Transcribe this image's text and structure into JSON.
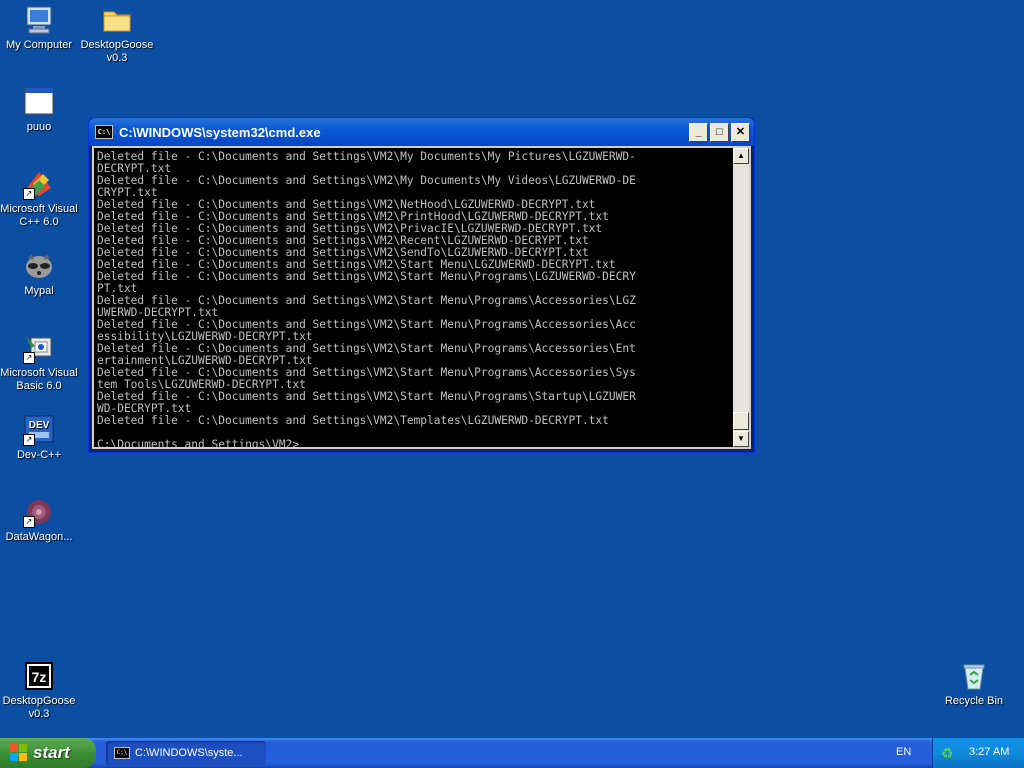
{
  "desktop": {
    "icons": [
      {
        "label_line1": "My Computer",
        "label_line2": "",
        "icon": "computer-icon"
      },
      {
        "label_line1": "DesktopGoose",
        "label_line2": "v0.3",
        "icon": "folder-icon"
      },
      {
        "label_line1": "puuo",
        "label_line2": "",
        "icon": "window-icon"
      },
      {
        "label_line1": "Microsoft Visual",
        "label_line2": "C++ 6.0",
        "icon": "visual-cpp-icon"
      },
      {
        "label_line1": "Mypal",
        "label_line2": "",
        "icon": "raccoon-icon"
      },
      {
        "label_line1": "Microsoft Visual",
        "label_line2": "Basic 6.0",
        "icon": "visual-basic-icon"
      },
      {
        "label_line1": "Dev-C++",
        "label_line2": "",
        "icon": "dev-cpp-icon"
      },
      {
        "label_line1": "DataWagon...",
        "label_line2": "",
        "icon": "datawagon-icon"
      },
      {
        "label_line1": "DesktopGoose",
        "label_line2": "v0.3",
        "icon": "7zip-icon"
      },
      {
        "label_line1": "Recycle Bin",
        "label_line2": "",
        "icon": "recycle-bin-icon"
      }
    ]
  },
  "cmd_window": {
    "title": "C:\\WINDOWS\\system32\\cmd.exe",
    "icon_text": "C:\\",
    "minimize": "_",
    "maximize": "□",
    "close": "✕",
    "lines": [
      "Deleted file - C:\\Documents and Settings\\VM2\\My Documents\\My Pictures\\LGZUWERWD-",
      "DECRYPT.txt",
      "Deleted file - C:\\Documents and Settings\\VM2\\My Documents\\My Videos\\LGZUWERWD-DE",
      "CRYPT.txt",
      "Deleted file - C:\\Documents and Settings\\VM2\\NetHood\\LGZUWERWD-DECRYPT.txt",
      "Deleted file - C:\\Documents and Settings\\VM2\\PrintHood\\LGZUWERWD-DECRYPT.txt",
      "Deleted file - C:\\Documents and Settings\\VM2\\PrivacIE\\LGZUWERWD-DECRYPT.txt",
      "Deleted file - C:\\Documents and Settings\\VM2\\Recent\\LGZUWERWD-DECRYPT.txt",
      "Deleted file - C:\\Documents and Settings\\VM2\\SendTo\\LGZUWERWD-DECRYPT.txt",
      "Deleted file - C:\\Documents and Settings\\VM2\\Start Menu\\LGZUWERWD-DECRYPT.txt",
      "Deleted file - C:\\Documents and Settings\\VM2\\Start Menu\\Programs\\LGZUWERWD-DECRY",
      "PT.txt",
      "Deleted file - C:\\Documents and Settings\\VM2\\Start Menu\\Programs\\Accessories\\LGZ",
      "UWERWD-DECRYPT.txt",
      "Deleted file - C:\\Documents and Settings\\VM2\\Start Menu\\Programs\\Accessories\\Acc",
      "essibility\\LGZUWERWD-DECRYPT.txt",
      "Deleted file - C:\\Documents and Settings\\VM2\\Start Menu\\Programs\\Accessories\\Ent",
      "ertainment\\LGZUWERWD-DECRYPT.txt",
      "Deleted file - C:\\Documents and Settings\\VM2\\Start Menu\\Programs\\Accessories\\Sys",
      "tem Tools\\LGZUWERWD-DECRYPT.txt",
      "Deleted file - C:\\Documents and Settings\\VM2\\Start Menu\\Programs\\Startup\\LGZUWER",
      "WD-DECRYPT.txt",
      "Deleted file - C:\\Documents and Settings\\VM2\\Templates\\LGZUWERWD-DECRYPT.txt",
      "",
      "C:\\Documents and Settings\\VM2>_"
    ]
  },
  "taskbar": {
    "start_label": "start",
    "task_cmd_label": "C:\\WINDOWS\\syste...",
    "language": "EN",
    "clock": "3:27 AM"
  }
}
